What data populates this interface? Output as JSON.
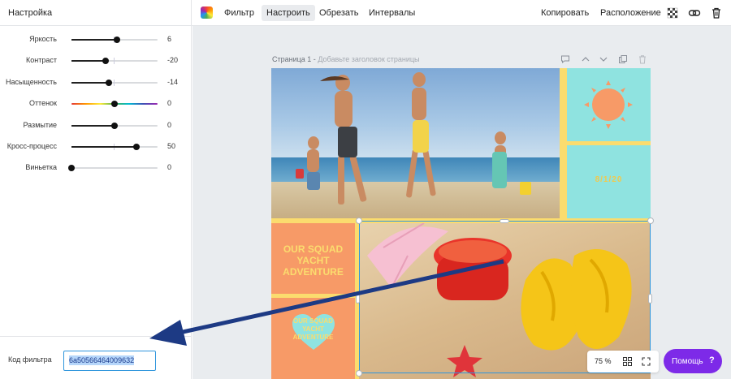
{
  "panel": {
    "title": "Настройка",
    "sliders": [
      {
        "label": "Яркость",
        "value": "6",
        "fraction": 0.53
      },
      {
        "label": "Контраст",
        "value": "-20",
        "fraction": 0.4
      },
      {
        "label": "Насыщенность",
        "value": "-14",
        "fraction": 0.43
      },
      {
        "label": "Оттенок",
        "value": "0",
        "fraction": 0.5
      },
      {
        "label": "Размытие",
        "value": "0",
        "fraction": 0.5
      },
      {
        "label": "Кросс-процесс",
        "value": "50",
        "fraction": 0.75
      },
      {
        "label": "Виньетка",
        "value": "0",
        "fraction": 0.0
      }
    ],
    "filter_code_label": "Код фильтра",
    "filter_code_value": "6a50566464009632"
  },
  "toolbar": {
    "filter": "Фильтр",
    "adjust": "Настроить",
    "crop": "Обрезать",
    "spacing": "Интервалы",
    "copy": "Копировать",
    "arrange": "Расположение"
  },
  "page": {
    "label": "Страница 1 -",
    "placeholder": "Добавьте заголовок страницы"
  },
  "design": {
    "date": "8/1/20",
    "squad_lines": [
      "OUR SQUAD",
      "YACHT",
      "ADVENTURE"
    ],
    "squad_small_lines": [
      "OUR SQUAD",
      "YACHT",
      "ADVENTURE"
    ]
  },
  "bottom": {
    "zoom": "75 %",
    "help": "Помощь",
    "help_mark": "?"
  },
  "colors": {
    "accent": "#7d2ae8",
    "selection": "#2f95dc",
    "teal": "#8fe3e0",
    "coral": "#f79a67",
    "yellow": "#fbdc6e",
    "arrow": "#1d3a84"
  },
  "icons": [
    "color-palette-icon",
    "transparency-icon",
    "link-icon",
    "trash-icon",
    "comment-icon",
    "chevron-up-icon",
    "chevron-down-icon",
    "duplicate-icon",
    "grid-icon",
    "expand-icon"
  ]
}
